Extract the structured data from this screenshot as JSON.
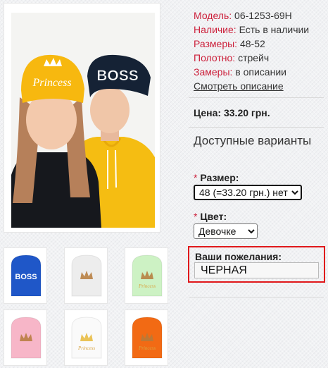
{
  "main_image": {
    "name": "product-photo-kids-hats"
  },
  "main_photo_text": {
    "left_hat": "Princess",
    "right_hat": "BOSS"
  },
  "thumbnails": [
    {
      "text": "BOSS",
      "color": "#1f57c8"
    },
    {
      "text": "",
      "color": "#ededed"
    },
    {
      "text": "Princess",
      "color": "#cdf2c4"
    },
    {
      "text": "",
      "color": "#f7b6c8"
    },
    {
      "text": "Princess",
      "color": "#fafafa"
    },
    {
      "text": "Princess",
      "color": "#f26a14"
    }
  ],
  "specs": [
    {
      "key": "Модель:",
      "value": "06-1253-69Н"
    },
    {
      "key": "Наличие:",
      "value": "Есть в наличии"
    },
    {
      "key": "Размеры:",
      "value": "48-52"
    },
    {
      "key": "Полотно:",
      "value": "стрейч"
    },
    {
      "key": "Замеры:",
      "value": "в описании"
    }
  ],
  "description_link": "Смотреть описание",
  "price": "Цена: 33.20 грн.",
  "variants_title": "Доступные варианты",
  "size": {
    "required_mark": "*",
    "label": "Размер:",
    "selected": "48 (=33.20 грн.) нет"
  },
  "color": {
    "required_mark": "*",
    "label": "Цвет:",
    "selected": "Девочке"
  },
  "wishes": {
    "label": "Ваши пожелания:",
    "value": "ЧЕРНАЯ"
  },
  "colors": {
    "accent_red": "#cc1f3a",
    "highlight_border": "#e0181b"
  }
}
